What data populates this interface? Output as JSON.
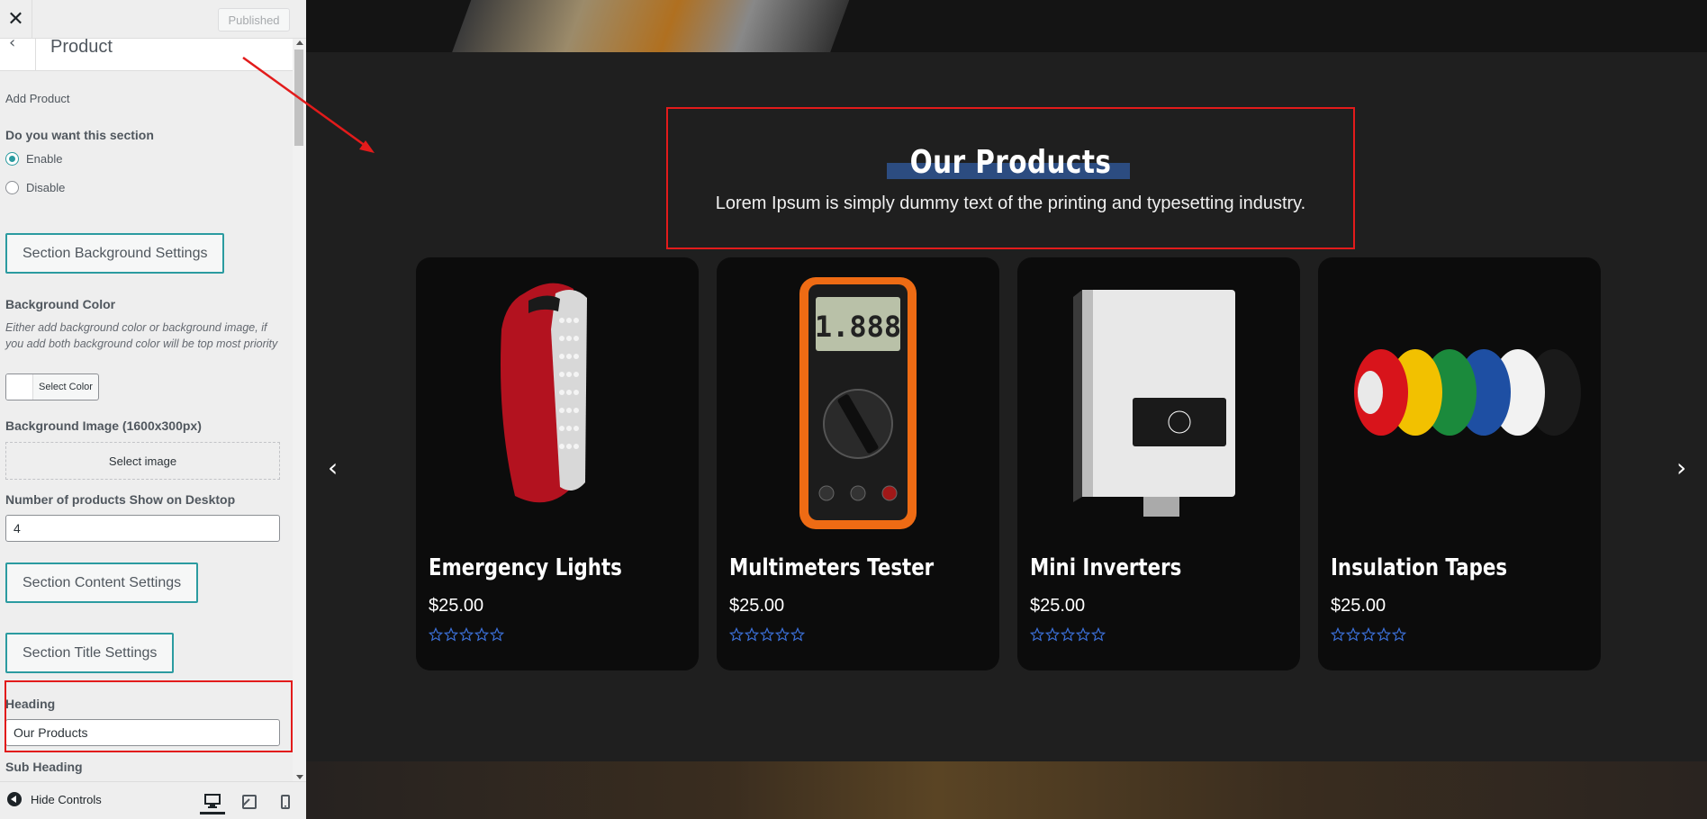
{
  "sidebar": {
    "published_label": "Published",
    "panel_title": "Product",
    "add_product": "Add Product",
    "enable_section_label": "Do you want this section",
    "options": [
      "Enable",
      "Disable"
    ],
    "selected_option": "Enable",
    "bg_settings_button": "Section Background Settings",
    "bg_color_label": "Background Color",
    "bg_color_desc": "Either add background color or background image, if you add both background color will be top most priority",
    "select_color": "Select Color",
    "bg_image_label": "Background Image (1600x300px)",
    "select_image": "Select image",
    "num_products_label": "Number of products Show on Desktop",
    "num_products_value": "4",
    "content_settings_button": "Section Content Settings",
    "title_settings_button": "Section Title Settings",
    "heading_label": "Heading",
    "heading_value": "Our Products",
    "sub_heading_label": "Sub Heading",
    "hide_controls": "Hide Controls"
  },
  "preview": {
    "section_title": "Our Products",
    "section_subtitle": "Lorem Ipsum is simply dummy text of the printing and typesetting industry.",
    "products": [
      {
        "name": "Emergency Lights",
        "price": "$25.00",
        "rating": 0
      },
      {
        "name": "Multimeters Tester",
        "price": "$25.00",
        "rating": 0
      },
      {
        "name": "Mini Inverters",
        "price": "$25.00",
        "rating": 0
      },
      {
        "name": "Insulation Tapes",
        "price": "$25.00",
        "rating": 0
      }
    ],
    "prev_icon": "chevron-left-icon",
    "next_icon": "chevron-right-icon"
  },
  "colors": {
    "accent": "#2b9ba0",
    "highlight": "#e21b1b",
    "title_bar": "#2c4c80",
    "star": "#3b6fd6"
  }
}
